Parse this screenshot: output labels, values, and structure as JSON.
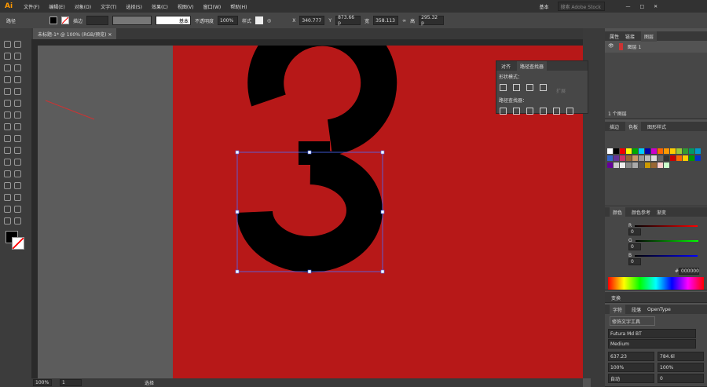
{
  "app": {
    "logo": "Ai",
    "workspace": "基本",
    "search_placeholder": "搜索 Adobe Stock"
  },
  "menu": [
    "文件(F)",
    "编辑(E)",
    "对象(O)",
    "文字(T)",
    "选择(S)",
    "效果(C)",
    "视图(V)",
    "窗口(W)",
    "帮助(H)"
  ],
  "control": {
    "label": "路径",
    "stroke_label": "描边",
    "profile": "基本",
    "opacity_label": "不透明度",
    "opacity": "100%",
    "style_label": "样式",
    "x": "340.777",
    "y": "873.66 p",
    "w": "358.113",
    "h": "295.32 p"
  },
  "document_tab": "未标题-1* @ 100% (RGB/预览)",
  "status": {
    "zoom": "100%",
    "page": "1",
    "tool": "选择"
  },
  "glyph": "3",
  "colors": {
    "artboard": "#b71818",
    "fill": "#000000"
  },
  "pathfinder": {
    "tabs": [
      "对齐",
      "路径查找器"
    ],
    "shape_modes": "形状模式：",
    "expand": "扩展",
    "pathfinders": "路径查找器："
  },
  "layers": {
    "tabs": [
      "属性",
      "链接",
      "图层"
    ],
    "layer_name": "图层 1",
    "count": "1 个图层"
  },
  "swatches": {
    "tabs": [
      "描边",
      "色板",
      "图形样式"
    ]
  },
  "color": {
    "tabs": [
      "颜色",
      "颜色参考",
      "渐变"
    ],
    "channels": [
      {
        "label": "R",
        "value": "0"
      },
      {
        "label": "G",
        "value": "0"
      },
      {
        "label": "B",
        "value": "0"
      }
    ],
    "hex": "000000"
  },
  "transform": {
    "title": "变换"
  },
  "character": {
    "tabs": [
      "字符",
      "段落",
      "OpenType"
    ],
    "touch_type": "修饰文字工具",
    "font": "Futura Md BT",
    "style": "Medium",
    "size": "637.23",
    "leading": "784.6l",
    "vscale": "100%",
    "hscale": "100%",
    "kerning": "自动",
    "tracking": "0"
  }
}
